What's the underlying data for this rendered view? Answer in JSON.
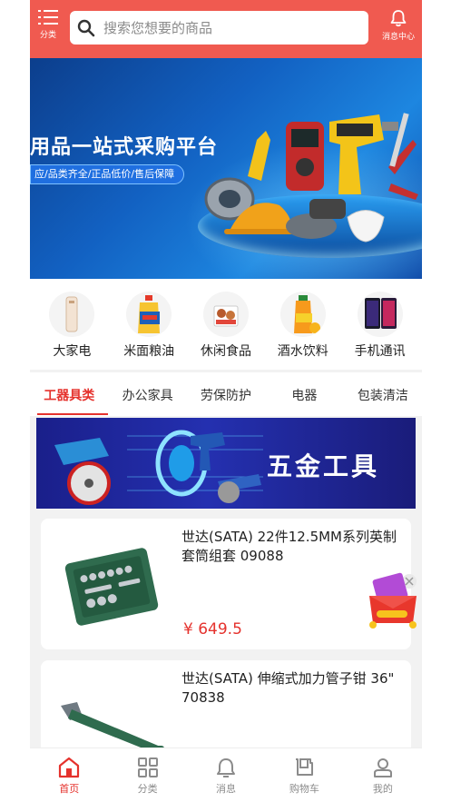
{
  "header": {
    "category_label": "分类",
    "search_placeholder": "搜索您想要的商品",
    "messages_label": "消息中心"
  },
  "banner": {
    "title": "用品一站式采购平台",
    "subtitle": "应/品类齐全/正品低价/售后保障",
    "slide_count": 5,
    "active_slide": 1
  },
  "categories": [
    {
      "label": "大家电",
      "icon": "appliance-icon"
    },
    {
      "label": "米面粮油",
      "icon": "cooking-oil-icon"
    },
    {
      "label": "休闲食品",
      "icon": "snack-icon"
    },
    {
      "label": "酒水饮料",
      "icon": "beverage-icon"
    },
    {
      "label": "手机通讯",
      "icon": "phone-icon"
    }
  ],
  "tabs": [
    {
      "label": "工器具类",
      "active": true
    },
    {
      "label": "办公家具",
      "active": false
    },
    {
      "label": "劳保防护",
      "active": false
    },
    {
      "label": "电器",
      "active": false
    },
    {
      "label": "包装清洁",
      "active": false
    }
  ],
  "section_banner": {
    "label": "五金工具"
  },
  "products": [
    {
      "name": "世达(SATA) 22件12.5MM系列英制套筒组套 09088",
      "price": "¥ 649.5"
    },
    {
      "name": "世达(SATA) 伸缩式加力管子钳 36\" 70838",
      "price": ""
    }
  ],
  "bottom_nav": [
    {
      "label": "首页",
      "icon": "home-icon",
      "active": true
    },
    {
      "label": "分类",
      "icon": "category-grid-icon",
      "active": false
    },
    {
      "label": "消息",
      "icon": "bell-icon",
      "active": false
    },
    {
      "label": "购物车",
      "icon": "cart-icon",
      "active": false
    },
    {
      "label": "我的",
      "icon": "user-icon",
      "active": false
    }
  ],
  "colors": {
    "brand": "#f05a50",
    "accent_red": "#e5322d",
    "nav_inactive": "#8b8b8b"
  }
}
